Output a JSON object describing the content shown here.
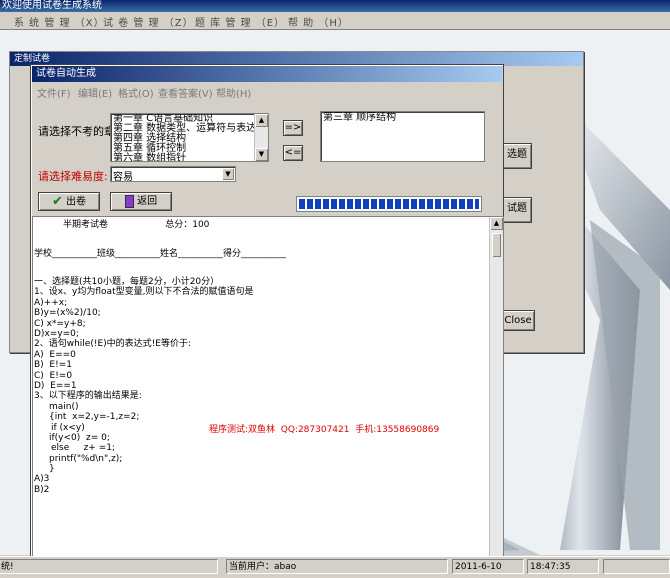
{
  "app": {
    "title": "欢迎使用试卷生成系统",
    "menu": [
      "系 统 管 理 （X）",
      "试 卷 管 理 （Z）",
      "题 库 管 理 （E）",
      "帮 助 （H）"
    ]
  },
  "behind_window": {
    "title": "定制试卷",
    "buttons": [
      "选题",
      "试题",
      "Close"
    ]
  },
  "front_window": {
    "title": "试卷自动生成",
    "menu": [
      "文件(F)",
      "编辑(E)",
      "格式(O)",
      "查看答案(V)",
      "帮助(H)"
    ],
    "exclude_label": "请选择不考的章：",
    "chapters": [
      "第一章 C语言基础知识",
      "第二章 数据类型、运算符与表达式",
      "第四章 选择结构",
      "第五章 循环控制",
      "第六章 数组指针"
    ],
    "excluded": [
      "第三章 顺序结构"
    ],
    "add_btn": "=>",
    "remove_btn": "<=",
    "difficulty_label": "请选择难易度:",
    "difficulty_value": "容易",
    "out_btn": "出卷",
    "back_btn": "返回",
    "progress": 1.0
  },
  "paper": {
    "header": "半期考试卷                    总分：100",
    "student_line": "学校__________班级__________姓名__________得分__________",
    "sec1": "一、选择题(共10小题，每题2分，小计20分）",
    "q1": "1、设x、y均为float型变量,则以下不合法的赋值语句是",
    "q1a": "A)++x;",
    "q1b": "B)y=(x%2)/10;",
    "q1c": "C) x*=y+8;",
    "q1d": "D)x=y=0;",
    "q2": "2、语句while(!E)中的表达式!E等价于:",
    "q2a": "A)  E==0",
    "q2b": "B)  E!=1",
    "q2c": "C)  E!=0",
    "q2d": "D)  E==1",
    "q3": "3、以下程序的输出结果是:",
    "c1": "main()",
    "c2": "{int  x=2,y=-1,z=2;",
    "c3": "if (x<y)",
    "c4": "if(y<0)  z= 0;",
    "c5": "else     z+ =1;",
    "c6": "printf(\"%d\\n\",z);",
    "c7": "}",
    "q3a": "A)3",
    "q3b": "B)2",
    "watermark": "程序测试:双鱼林  QQ:287307421  手机:13558690869"
  },
  "status": {
    "left": "统!",
    "user": "当前用户：abao",
    "date": "2011-6-10",
    "time": "18:47:35"
  }
}
